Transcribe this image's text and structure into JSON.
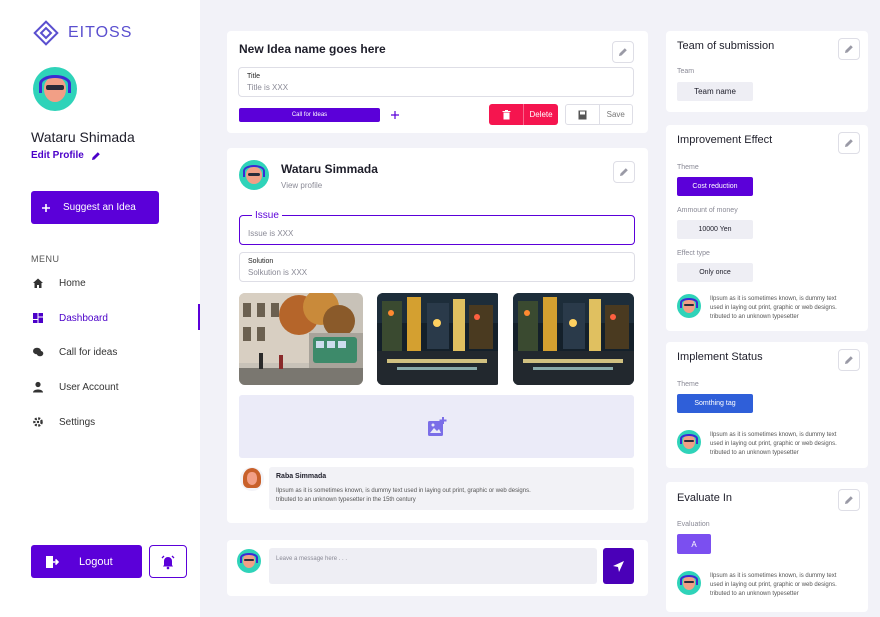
{
  "app": {
    "brand": "EITOSS",
    "accent": "#5b00d9",
    "danger": "#f5154f",
    "info": "#2f5fd9"
  },
  "profile": {
    "name": "Wataru Shimada",
    "edit_label": "Edit Profile"
  },
  "sidebar": {
    "suggest_label": "Suggest an Idea",
    "menu_title": "MENU",
    "items": [
      {
        "label": "Home",
        "icon": "home-icon"
      },
      {
        "label": "Dashboard",
        "icon": "dashboard-icon"
      },
      {
        "label": "Call for ideas",
        "icon": "chat-icon"
      },
      {
        "label": "User Account",
        "icon": "user-icon"
      },
      {
        "label": "Settings",
        "icon": "gear-icon"
      }
    ],
    "active_item": "Dashboard",
    "logout_label": "Logout"
  },
  "idea": {
    "title": "New Idea name goes here",
    "title_field": {
      "label": "Title",
      "placeholder": "Title is XXX"
    },
    "call_chip": "Call for Ideas",
    "delete_label": "Delete",
    "save_label": "Save"
  },
  "author": {
    "name": "Wataru Simmada",
    "view_profile": "View profile"
  },
  "issue": {
    "label": "Issue",
    "placeholder": "Issue is XXX"
  },
  "solution": {
    "label": "Solution",
    "placeholder": "Solkution is XXX"
  },
  "photos": [
    "street-tram-photo",
    "night-market-photo",
    "night-market-photo"
  ],
  "comment": {
    "author": "Raba Simmada",
    "text_line1": "Ilpsum as it is sometimes known, is dummy text used in laying out print, graphic or web designs.",
    "text_line2": "tributed to an unknown typesetter in the 15th century"
  },
  "message": {
    "placeholder": "Leave a message here . . ."
  },
  "team": {
    "title": "Team of submission",
    "label": "Team",
    "value": "Team name"
  },
  "improvement": {
    "title": "Improvement Effect",
    "theme_label": "Theme",
    "theme_value": "Cost reduction",
    "money_label": "Ammount of money",
    "money_value": "10000 Yen",
    "effect_label": "Effect type",
    "effect_value": "Only once",
    "note_line1": "Ilpsum as it is sometimes known, is dummy text",
    "note_line2": "used in laying out print, graphic or web designs.",
    "note_line3": "tributed to an unknown typesetter"
  },
  "implement": {
    "title": "Implement Status",
    "theme_label": "Theme",
    "theme_value": "Somthing tag",
    "note_line1": "Ilpsum as it is sometimes known, is dummy text",
    "note_line2": "used in laying out print, graphic or web designs.",
    "note_line3": "tributed to an unknown typesetter"
  },
  "evaluate": {
    "title": "Evaluate In",
    "label": "Evaluation",
    "value": "A",
    "note_line1": "Ilpsum as it is sometimes known, is dummy text",
    "note_line2": "used in laying out print, graphic or web designs.",
    "note_line3": "tributed to an unknown typesetter"
  }
}
